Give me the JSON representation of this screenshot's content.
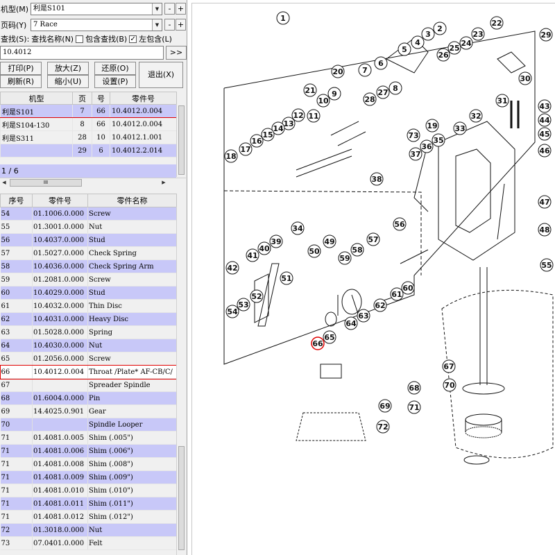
{
  "toolbar": {
    "model_label": "机型(M)",
    "model_value": "利是S101",
    "page_label": "页码(Y)",
    "page_value": "7 Race",
    "minus": "-",
    "plus": "+",
    "search_label": "查找(S):",
    "search_name_label": "查找名称(N)",
    "contain_search_label": "包含查找(B)",
    "contain_search_checked": false,
    "left_contain_label": "左包含(L)",
    "left_contain_checked": true,
    "search_value": "10.4012",
    "go_button": ">>",
    "print_button": "打印(P)",
    "zoom_in_button": "放大(Z)",
    "restore_button": "还原(O)",
    "exit_button": "退出(X)",
    "refresh_button": "刷新(R)",
    "zoom_out_button": "缩小(U)",
    "settings_button": "设置(P)"
  },
  "model_table": {
    "headers": [
      "机型",
      "页",
      "号",
      "零件号"
    ],
    "rows": [
      {
        "model": "利是S101",
        "page": "7",
        "num": "66",
        "part": "10.4012.0.004"
      },
      {
        "model": "利是S104-130",
        "page": "8",
        "num": "66",
        "part": "10.4012.0.004"
      },
      {
        "model": "利是S311",
        "page": "28",
        "num": "10",
        "part": "10.4012.1.001"
      },
      {
        "model": "",
        "page": "29",
        "num": "6",
        "part": "10.4012.2.014"
      }
    ],
    "pager": "1 / 6",
    "hscroll_label": "III"
  },
  "parts_table": {
    "headers": [
      "序号",
      "零件号",
      "零件名称"
    ],
    "rows": [
      {
        "seq": "54",
        "part": "01.1006.0.000",
        "name": "Screw"
      },
      {
        "seq": "55",
        "part": "01.3001.0.000",
        "name": "Nut"
      },
      {
        "seq": "56",
        "part": "10.4037.0.000",
        "name": "Stud"
      },
      {
        "seq": "57",
        "part": "01.5027.0.000",
        "name": "Check Spring"
      },
      {
        "seq": "58",
        "part": "10.4036.0.000",
        "name": "Check Spring Arm"
      },
      {
        "seq": "59",
        "part": "01.2081.0.000",
        "name": "Screw"
      },
      {
        "seq": "60",
        "part": "10.4029.0.000",
        "name": "Stud"
      },
      {
        "seq": "61",
        "part": "10.4032.0.000",
        "name": "Thin Disc"
      },
      {
        "seq": "62",
        "part": "10.4031.0.000",
        "name": "Heavy Disc"
      },
      {
        "seq": "63",
        "part": "01.5028.0.000",
        "name": "Spring"
      },
      {
        "seq": "64",
        "part": "10.4030.0.000",
        "name": "Nut"
      },
      {
        "seq": "65",
        "part": "01.2056.0.000",
        "name": "Screw"
      },
      {
        "seq": "66",
        "part": "10.4012.0.004",
        "name": "Throat /Plate* AF-CB/C/"
      },
      {
        "seq": "67",
        "part": "",
        "name": "Spreader Spindle"
      },
      {
        "seq": "68",
        "part": "01.6004.0.000",
        "name": "Pin"
      },
      {
        "seq": "69",
        "part": "14.4025.0.901",
        "name": "Gear"
      },
      {
        "seq": "70",
        "part": "",
        "name": "Spindle Looper"
      },
      {
        "seq": "71",
        "part": "01.4081.0.005",
        "name": "Shim (.005\")"
      },
      {
        "seq": "71",
        "part": "01.4081.0.006",
        "name": "Shim (.006\")"
      },
      {
        "seq": "71",
        "part": "01.4081.0.008",
        "name": "Shim (.008\")"
      },
      {
        "seq": "71",
        "part": "01.4081.0.009",
        "name": "Shim (.009\")"
      },
      {
        "seq": "71",
        "part": "01.4081.0.010",
        "name": "Shim (.010\")"
      },
      {
        "seq": "71",
        "part": "01.4081.0.011",
        "name": "Shim (.011\")"
      },
      {
        "seq": "71",
        "part": "01.4081.0.012",
        "name": "Shim (.012\")"
      },
      {
        "seq": "72",
        "part": "01.3018.0.000",
        "name": "Nut"
      },
      {
        "seq": "73",
        "part": "07.0401.0.000",
        "name": "Felt"
      }
    ],
    "selected_seq": "66"
  },
  "diagram": {
    "callouts": [
      "1",
      "2",
      "3",
      "4",
      "5",
      "6",
      "7",
      "8",
      "9",
      "10",
      "11",
      "12",
      "13",
      "14",
      "15",
      "16",
      "17",
      "18",
      "19",
      "20",
      "21",
      "22",
      "23",
      "24",
      "25",
      "26",
      "27",
      "28",
      "29",
      "30",
      "31",
      "32",
      "33",
      "34",
      "35",
      "36",
      "37",
      "38",
      "39",
      "40",
      "41",
      "42",
      "43",
      "44",
      "45",
      "46",
      "47",
      "48",
      "49",
      "50",
      "51",
      "52",
      "53",
      "54",
      "55",
      "56",
      "57",
      "58",
      "59",
      "60",
      "61",
      "62",
      "63",
      "64",
      "65",
      "66",
      "67",
      "68",
      "69",
      "70",
      "71",
      "72",
      "73"
    ],
    "highlighted_callout": "66"
  },
  "colors": {
    "row_highlight": "#c8c8f8",
    "selection_border": "#e00000",
    "panel_bg": "#f0f0f0"
  }
}
